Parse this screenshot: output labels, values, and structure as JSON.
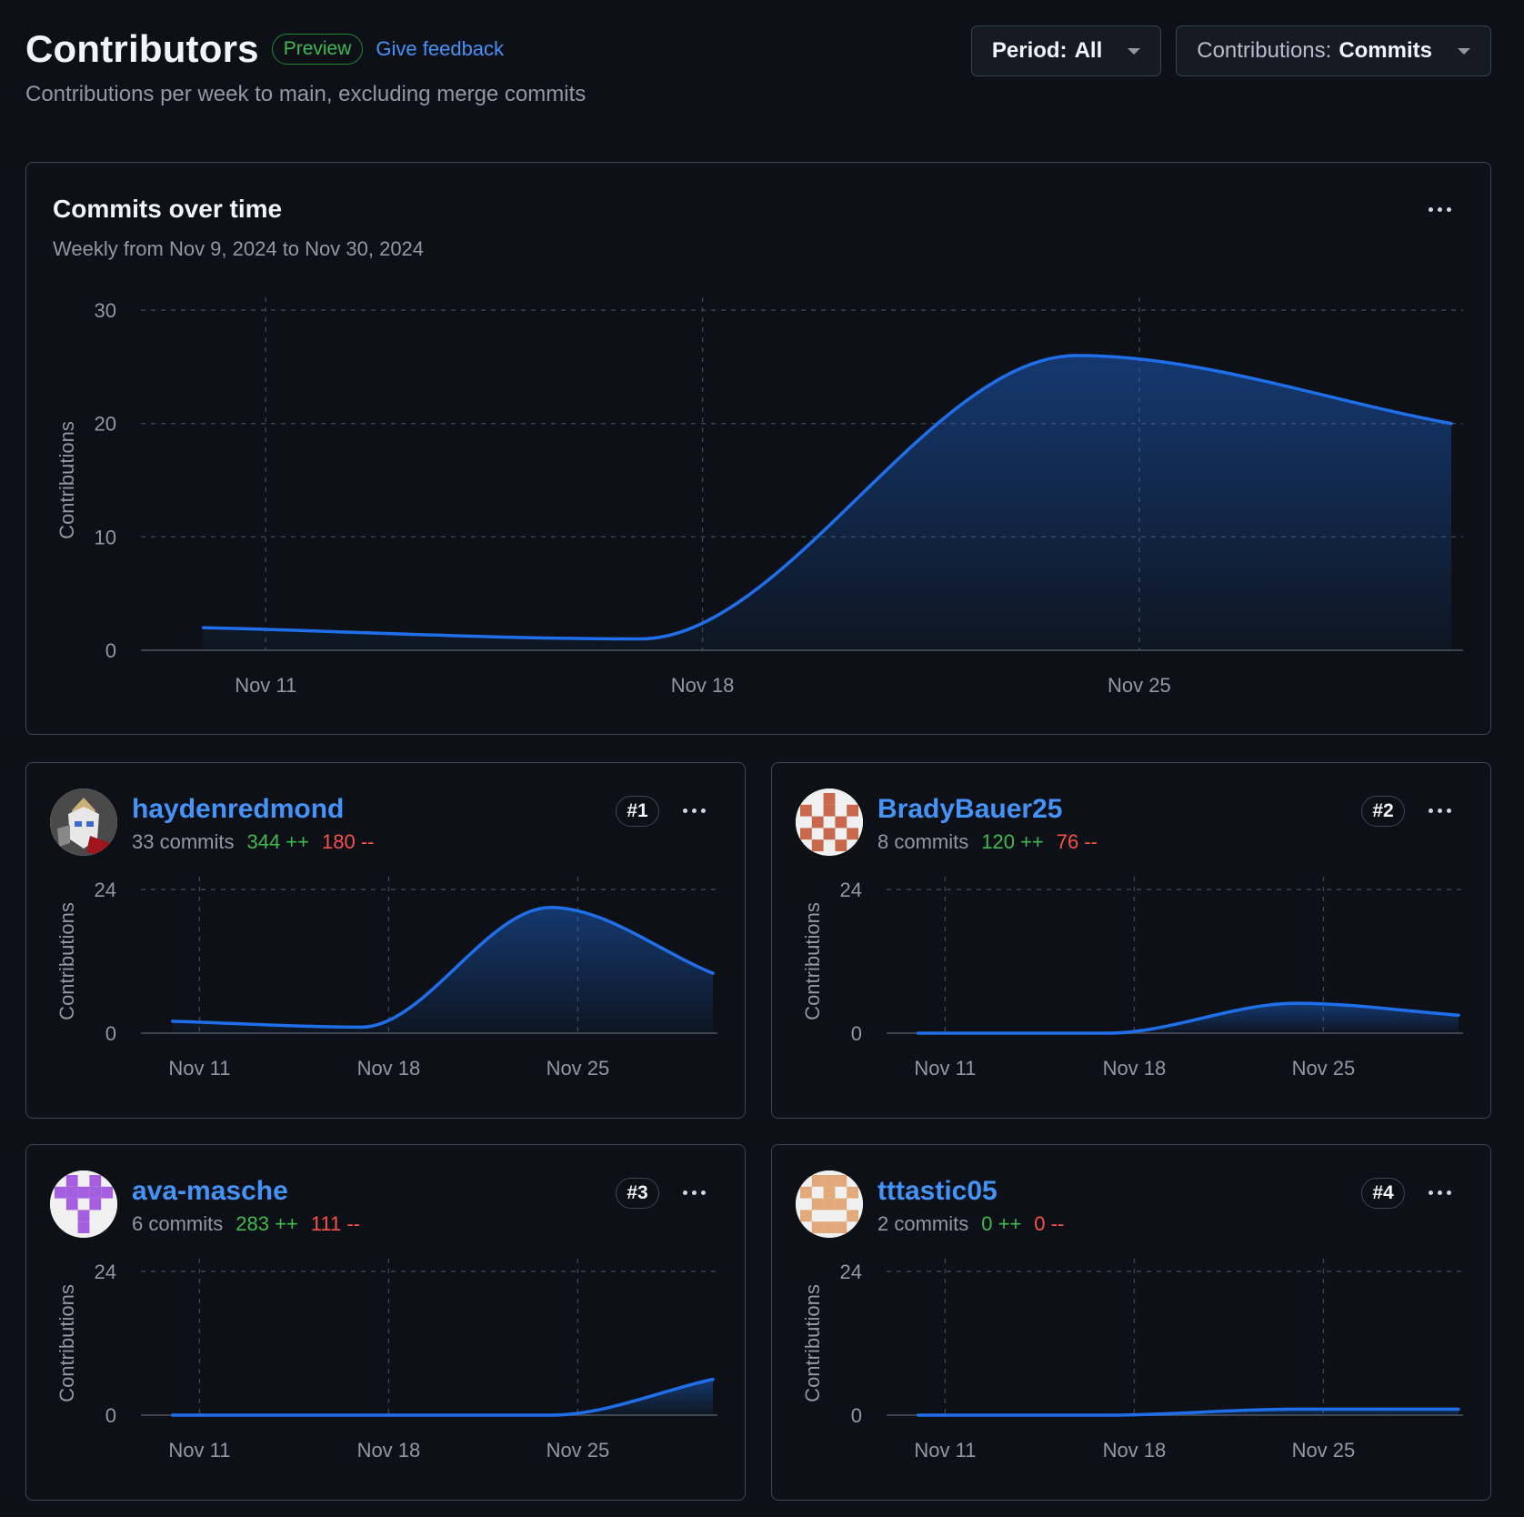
{
  "header": {
    "title": "Contributors",
    "badge": "Preview",
    "feedback_link": "Give feedback",
    "subtitle": "Contributions per week to main, excluding merge commits"
  },
  "filters": {
    "period_label": "Period:",
    "period_value": "All",
    "contrib_label": "Contributions:",
    "contrib_value": "Commits"
  },
  "main_chart": {
    "title": "Commits over time",
    "subtitle": "Weekly from Nov 9, 2024 to Nov 30, 2024"
  },
  "chart_data": [
    {
      "type": "area",
      "title": "Commits over time",
      "subtitle": "Weekly from Nov 9, 2024 to Nov 30, 2024",
      "ylabel": "Contributions",
      "x": [
        "Nov 10",
        "Nov 17",
        "Nov 24",
        "Nov 30"
      ],
      "values": [
        2,
        1,
        26,
        20
      ],
      "xticks": [
        "Nov 11",
        "Nov 18",
        "Nov 25"
      ],
      "yticks": [
        0,
        10,
        20,
        30
      ],
      "ylim": [
        0,
        30
      ],
      "grid": true,
      "color": "#1f6feb"
    },
    {
      "type": "area",
      "name": "haydenredmond",
      "ylabel": "Contributions",
      "x": [
        "Nov 10",
        "Nov 17",
        "Nov 24",
        "Nov 30"
      ],
      "values": [
        2,
        1,
        21,
        10
      ],
      "xticks": [
        "Nov 11",
        "Nov 18",
        "Nov 25"
      ],
      "yticks": [
        0,
        24
      ],
      "ylim": [
        0,
        24
      ]
    },
    {
      "type": "area",
      "name": "BradyBauer25",
      "ylabel": "Contributions",
      "x": [
        "Nov 10",
        "Nov 17",
        "Nov 24",
        "Nov 30"
      ],
      "values": [
        0,
        0,
        5,
        3
      ],
      "xticks": [
        "Nov 11",
        "Nov 18",
        "Nov 25"
      ],
      "yticks": [
        0,
        24
      ],
      "ylim": [
        0,
        24
      ]
    },
    {
      "type": "area",
      "name": "ava-masche",
      "ylabel": "Contributions",
      "x": [
        "Nov 10",
        "Nov 17",
        "Nov 24",
        "Nov 30"
      ],
      "values": [
        0,
        0,
        0,
        6
      ],
      "xticks": [
        "Nov 11",
        "Nov 18",
        "Nov 25"
      ],
      "yticks": [
        0,
        24
      ],
      "ylim": [
        0,
        24
      ]
    },
    {
      "type": "area",
      "name": "tttastic05",
      "ylabel": "Contributions",
      "x": [
        "Nov 10",
        "Nov 17",
        "Nov 24",
        "Nov 30"
      ],
      "values": [
        0,
        0,
        1,
        1
      ],
      "xticks": [
        "Nov 11",
        "Nov 18",
        "Nov 25"
      ],
      "yticks": [
        0,
        24
      ],
      "ylim": [
        0,
        24
      ]
    }
  ],
  "contributors": [
    {
      "username": "haydenredmond",
      "commits": "33 commits",
      "additions": "344 ++",
      "deletions": "180 --",
      "rank": "#1",
      "avatar": "robot-avatar"
    },
    {
      "username": "BradyBauer25",
      "commits": "8 commits",
      "additions": "120 ++",
      "deletions": "76 --",
      "rank": "#2",
      "avatar": "identicon-red"
    },
    {
      "username": "ava-masche",
      "commits": "6 commits",
      "additions": "283 ++",
      "deletions": "111 --",
      "rank": "#3",
      "avatar": "identicon-purple"
    },
    {
      "username": "tttastic05",
      "commits": "2 commits",
      "additions": "0 ++",
      "deletions": "0 --",
      "rank": "#4",
      "avatar": "identicon-peach"
    }
  ]
}
